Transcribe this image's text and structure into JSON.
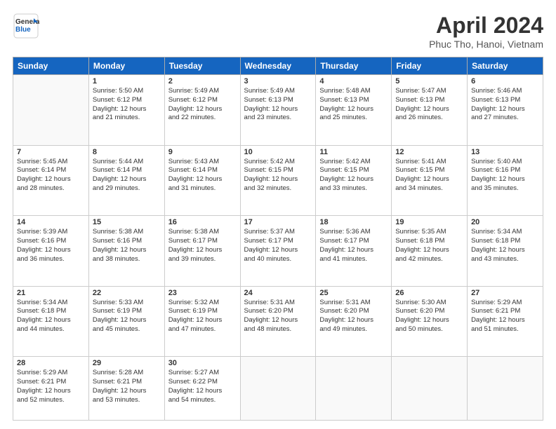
{
  "header": {
    "logo_line1": "General",
    "logo_line2": "Blue",
    "month_year": "April 2024",
    "location": "Phuc Tho, Hanoi, Vietnam"
  },
  "weekdays": [
    "Sunday",
    "Monday",
    "Tuesday",
    "Wednesday",
    "Thursday",
    "Friday",
    "Saturday"
  ],
  "weeks": [
    [
      {
        "day": "",
        "text": ""
      },
      {
        "day": "1",
        "text": "Sunrise: 5:50 AM\nSunset: 6:12 PM\nDaylight: 12 hours\nand 21 minutes."
      },
      {
        "day": "2",
        "text": "Sunrise: 5:49 AM\nSunset: 6:12 PM\nDaylight: 12 hours\nand 22 minutes."
      },
      {
        "day": "3",
        "text": "Sunrise: 5:49 AM\nSunset: 6:13 PM\nDaylight: 12 hours\nand 23 minutes."
      },
      {
        "day": "4",
        "text": "Sunrise: 5:48 AM\nSunset: 6:13 PM\nDaylight: 12 hours\nand 25 minutes."
      },
      {
        "day": "5",
        "text": "Sunrise: 5:47 AM\nSunset: 6:13 PM\nDaylight: 12 hours\nand 26 minutes."
      },
      {
        "day": "6",
        "text": "Sunrise: 5:46 AM\nSunset: 6:13 PM\nDaylight: 12 hours\nand 27 minutes."
      }
    ],
    [
      {
        "day": "7",
        "text": "Sunrise: 5:45 AM\nSunset: 6:14 PM\nDaylight: 12 hours\nand 28 minutes."
      },
      {
        "day": "8",
        "text": "Sunrise: 5:44 AM\nSunset: 6:14 PM\nDaylight: 12 hours\nand 29 minutes."
      },
      {
        "day": "9",
        "text": "Sunrise: 5:43 AM\nSunset: 6:14 PM\nDaylight: 12 hours\nand 31 minutes."
      },
      {
        "day": "10",
        "text": "Sunrise: 5:42 AM\nSunset: 6:15 PM\nDaylight: 12 hours\nand 32 minutes."
      },
      {
        "day": "11",
        "text": "Sunrise: 5:42 AM\nSunset: 6:15 PM\nDaylight: 12 hours\nand 33 minutes."
      },
      {
        "day": "12",
        "text": "Sunrise: 5:41 AM\nSunset: 6:15 PM\nDaylight: 12 hours\nand 34 minutes."
      },
      {
        "day": "13",
        "text": "Sunrise: 5:40 AM\nSunset: 6:16 PM\nDaylight: 12 hours\nand 35 minutes."
      }
    ],
    [
      {
        "day": "14",
        "text": "Sunrise: 5:39 AM\nSunset: 6:16 PM\nDaylight: 12 hours\nand 36 minutes."
      },
      {
        "day": "15",
        "text": "Sunrise: 5:38 AM\nSunset: 6:16 PM\nDaylight: 12 hours\nand 38 minutes."
      },
      {
        "day": "16",
        "text": "Sunrise: 5:38 AM\nSunset: 6:17 PM\nDaylight: 12 hours\nand 39 minutes."
      },
      {
        "day": "17",
        "text": "Sunrise: 5:37 AM\nSunset: 6:17 PM\nDaylight: 12 hours\nand 40 minutes."
      },
      {
        "day": "18",
        "text": "Sunrise: 5:36 AM\nSunset: 6:17 PM\nDaylight: 12 hours\nand 41 minutes."
      },
      {
        "day": "19",
        "text": "Sunrise: 5:35 AM\nSunset: 6:18 PM\nDaylight: 12 hours\nand 42 minutes."
      },
      {
        "day": "20",
        "text": "Sunrise: 5:34 AM\nSunset: 6:18 PM\nDaylight: 12 hours\nand 43 minutes."
      }
    ],
    [
      {
        "day": "21",
        "text": "Sunrise: 5:34 AM\nSunset: 6:18 PM\nDaylight: 12 hours\nand 44 minutes."
      },
      {
        "day": "22",
        "text": "Sunrise: 5:33 AM\nSunset: 6:19 PM\nDaylight: 12 hours\nand 45 minutes."
      },
      {
        "day": "23",
        "text": "Sunrise: 5:32 AM\nSunset: 6:19 PM\nDaylight: 12 hours\nand 47 minutes."
      },
      {
        "day": "24",
        "text": "Sunrise: 5:31 AM\nSunset: 6:20 PM\nDaylight: 12 hours\nand 48 minutes."
      },
      {
        "day": "25",
        "text": "Sunrise: 5:31 AM\nSunset: 6:20 PM\nDaylight: 12 hours\nand 49 minutes."
      },
      {
        "day": "26",
        "text": "Sunrise: 5:30 AM\nSunset: 6:20 PM\nDaylight: 12 hours\nand 50 minutes."
      },
      {
        "day": "27",
        "text": "Sunrise: 5:29 AM\nSunset: 6:21 PM\nDaylight: 12 hours\nand 51 minutes."
      }
    ],
    [
      {
        "day": "28",
        "text": "Sunrise: 5:29 AM\nSunset: 6:21 PM\nDaylight: 12 hours\nand 52 minutes."
      },
      {
        "day": "29",
        "text": "Sunrise: 5:28 AM\nSunset: 6:21 PM\nDaylight: 12 hours\nand 53 minutes."
      },
      {
        "day": "30",
        "text": "Sunrise: 5:27 AM\nSunset: 6:22 PM\nDaylight: 12 hours\nand 54 minutes."
      },
      {
        "day": "",
        "text": ""
      },
      {
        "day": "",
        "text": ""
      },
      {
        "day": "",
        "text": ""
      },
      {
        "day": "",
        "text": ""
      }
    ]
  ]
}
